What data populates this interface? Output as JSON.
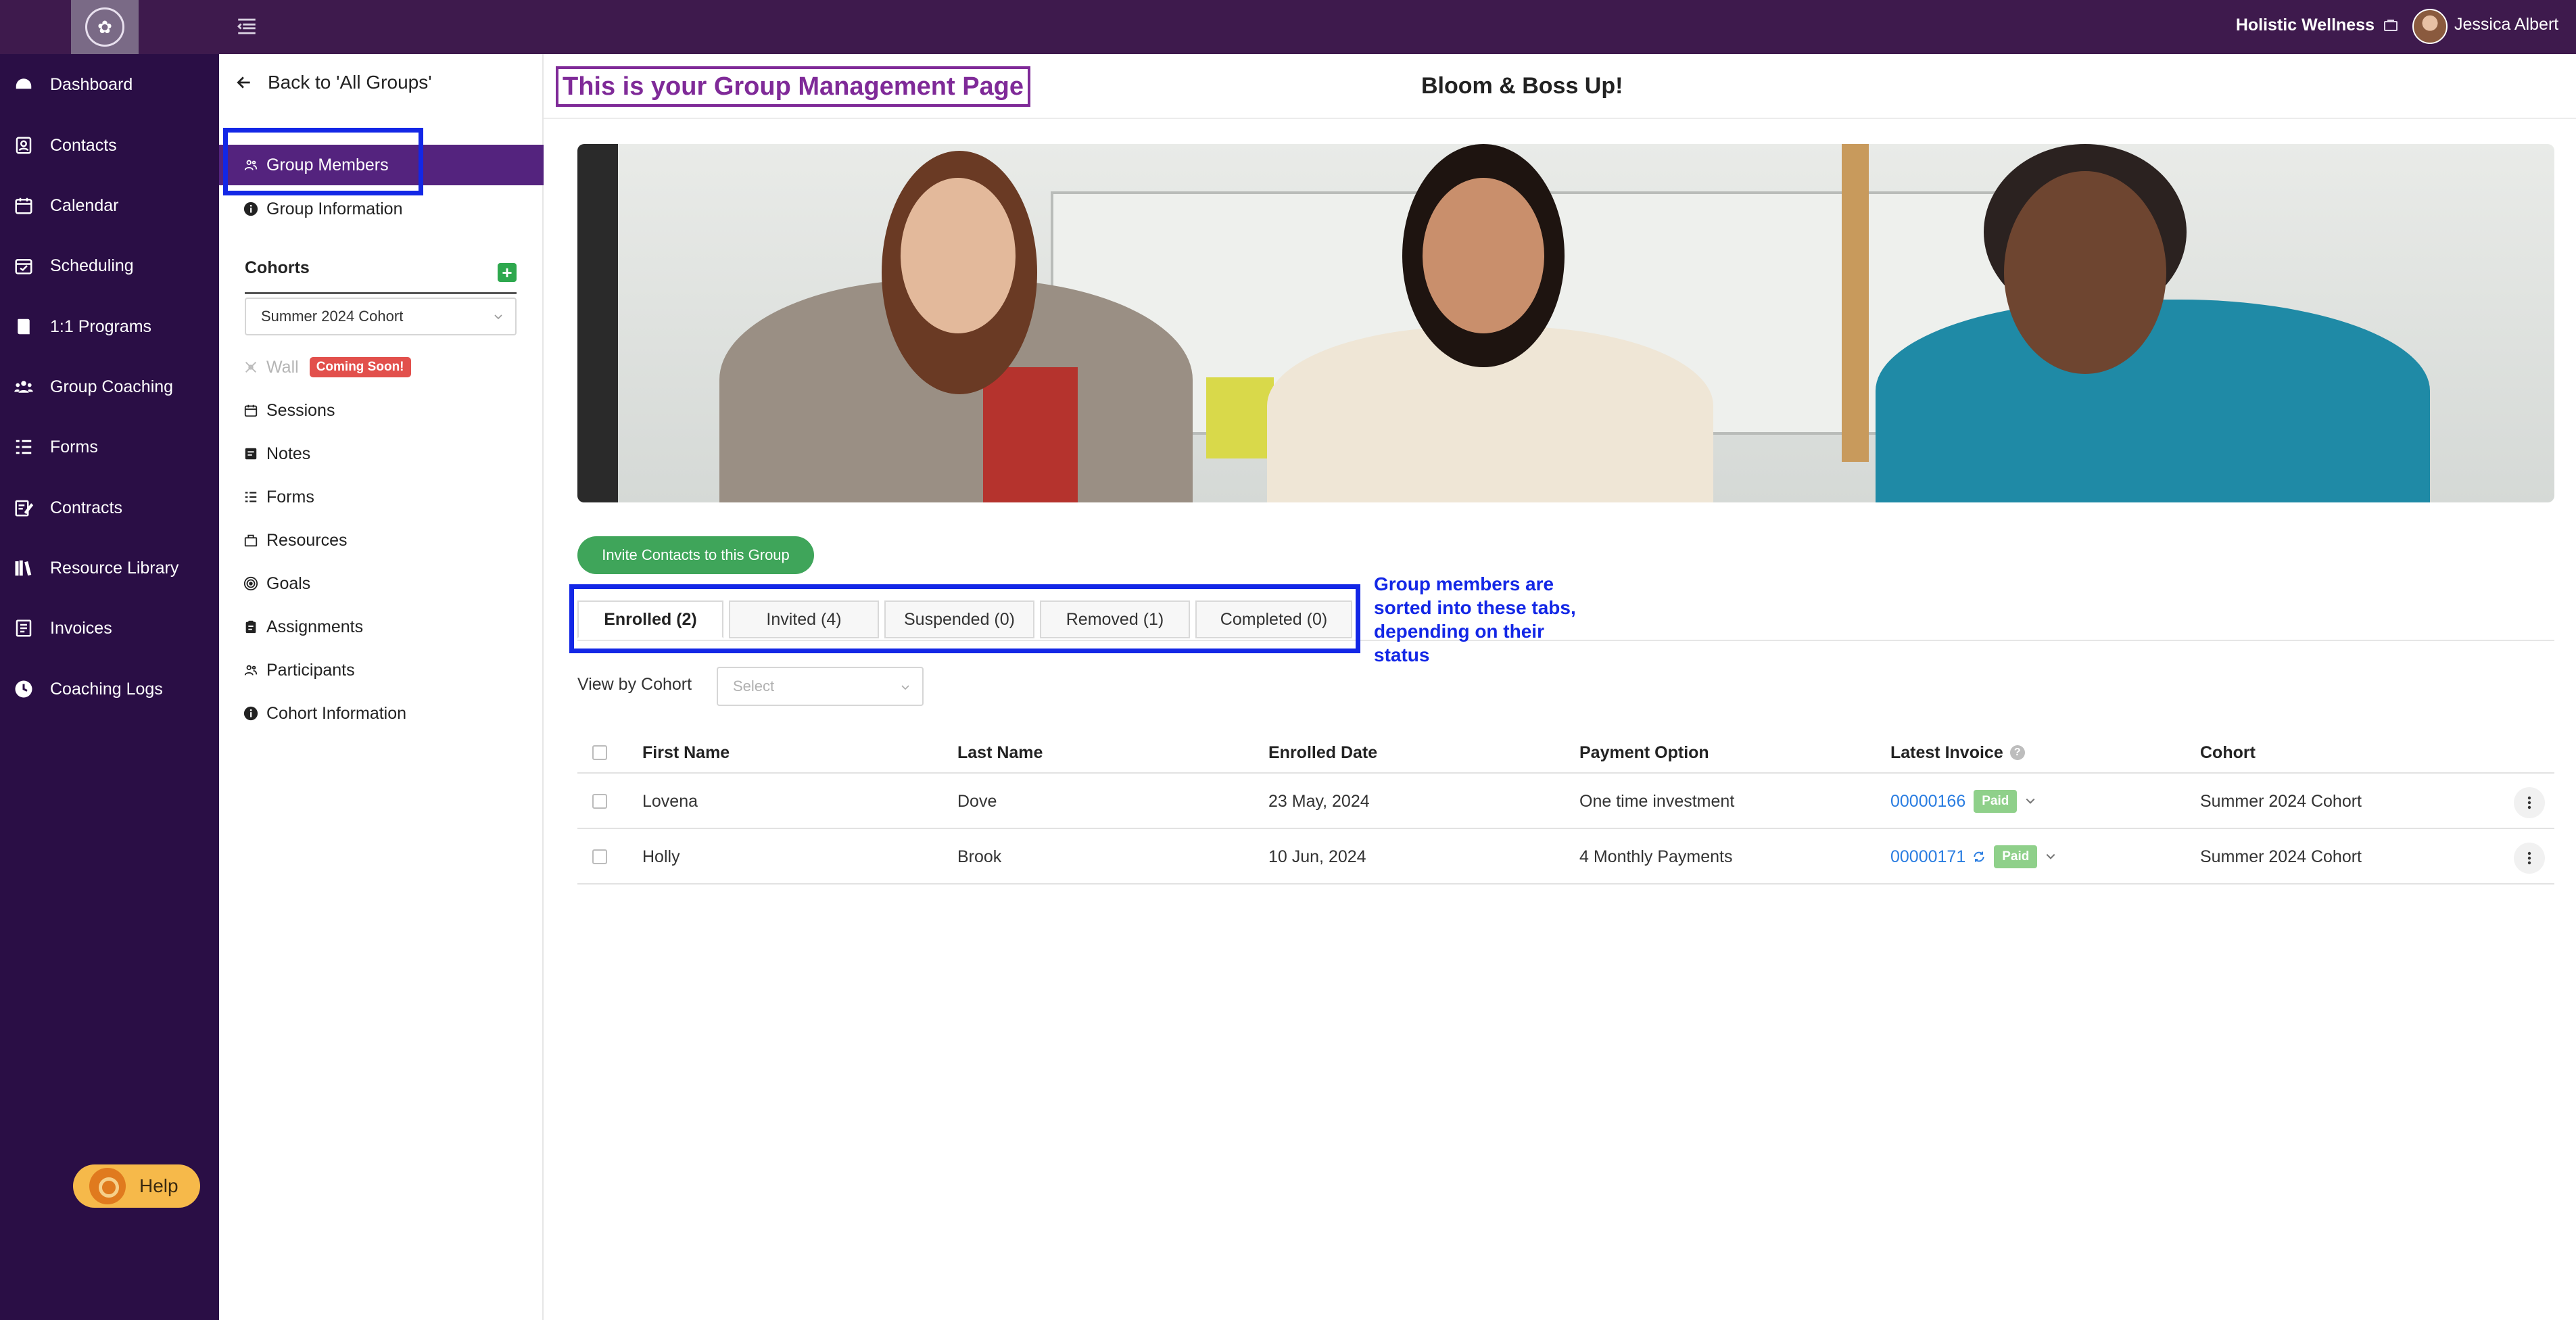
{
  "topbar": {
    "org_name": "Holistic Wellness",
    "user_name": "Jessica Albert"
  },
  "main_nav": [
    {
      "label": "Dashboard",
      "icon": "dashboard-icon"
    },
    {
      "label": "Contacts",
      "icon": "contacts-icon"
    },
    {
      "label": "Calendar",
      "icon": "calendar-icon"
    },
    {
      "label": "Scheduling",
      "icon": "scheduling-icon"
    },
    {
      "label": "1:1 Programs",
      "icon": "programs-icon"
    },
    {
      "label": "Group Coaching",
      "icon": "group-coaching-icon"
    },
    {
      "label": "Forms",
      "icon": "forms-icon"
    },
    {
      "label": "Contracts",
      "icon": "contracts-icon"
    },
    {
      "label": "Resource Library",
      "icon": "resource-library-icon"
    },
    {
      "label": "Invoices",
      "icon": "invoices-icon"
    },
    {
      "label": "Coaching Logs",
      "icon": "coaching-logs-icon"
    }
  ],
  "help_label": "Help",
  "sub_nav": {
    "back_label": "Back to 'All Groups'",
    "group_members": "Group Members",
    "group_information": "Group Information",
    "cohorts_label": "Cohorts",
    "cohort_selected": "Summer 2024 Cohort",
    "wall": "Wall",
    "coming_soon": "Coming Soon!",
    "items": [
      "Sessions",
      "Notes",
      "Forms",
      "Resources",
      "Goals",
      "Assignments",
      "Participants",
      "Cohort Information"
    ]
  },
  "header": {
    "annotation": "This is your Group Management Page",
    "group_title": "Bloom & Boss Up!"
  },
  "invite_label": "Invite Contacts to this Group",
  "tabs": [
    "Enrolled (2)",
    "Invited (4)",
    "Suspended (0)",
    "Removed (1)",
    "Completed (0)"
  ],
  "tabs_annotation": "Group members are sorted into these tabs, depending on their status",
  "view_by_cohort_label": "View by Cohort",
  "view_by_cohort_placeholder": "Select",
  "table": {
    "columns": [
      "First Name",
      "Last Name",
      "Enrolled Date",
      "Payment Option",
      "Latest Invoice",
      "Cohort"
    ],
    "rows": [
      {
        "first": "Lovena",
        "last": "Dove",
        "date": "23 May, 2024",
        "payment": "One time investment",
        "invoice": "00000166",
        "status": "Paid",
        "cohort": "Summer 2024 Cohort"
      },
      {
        "first": "Holly",
        "last": "Brook",
        "date": "10 Jun, 2024",
        "payment": "4 Monthly Payments",
        "invoice": "00000171",
        "status": "Paid",
        "cohort": "Summer 2024 Cohort"
      }
    ]
  }
}
